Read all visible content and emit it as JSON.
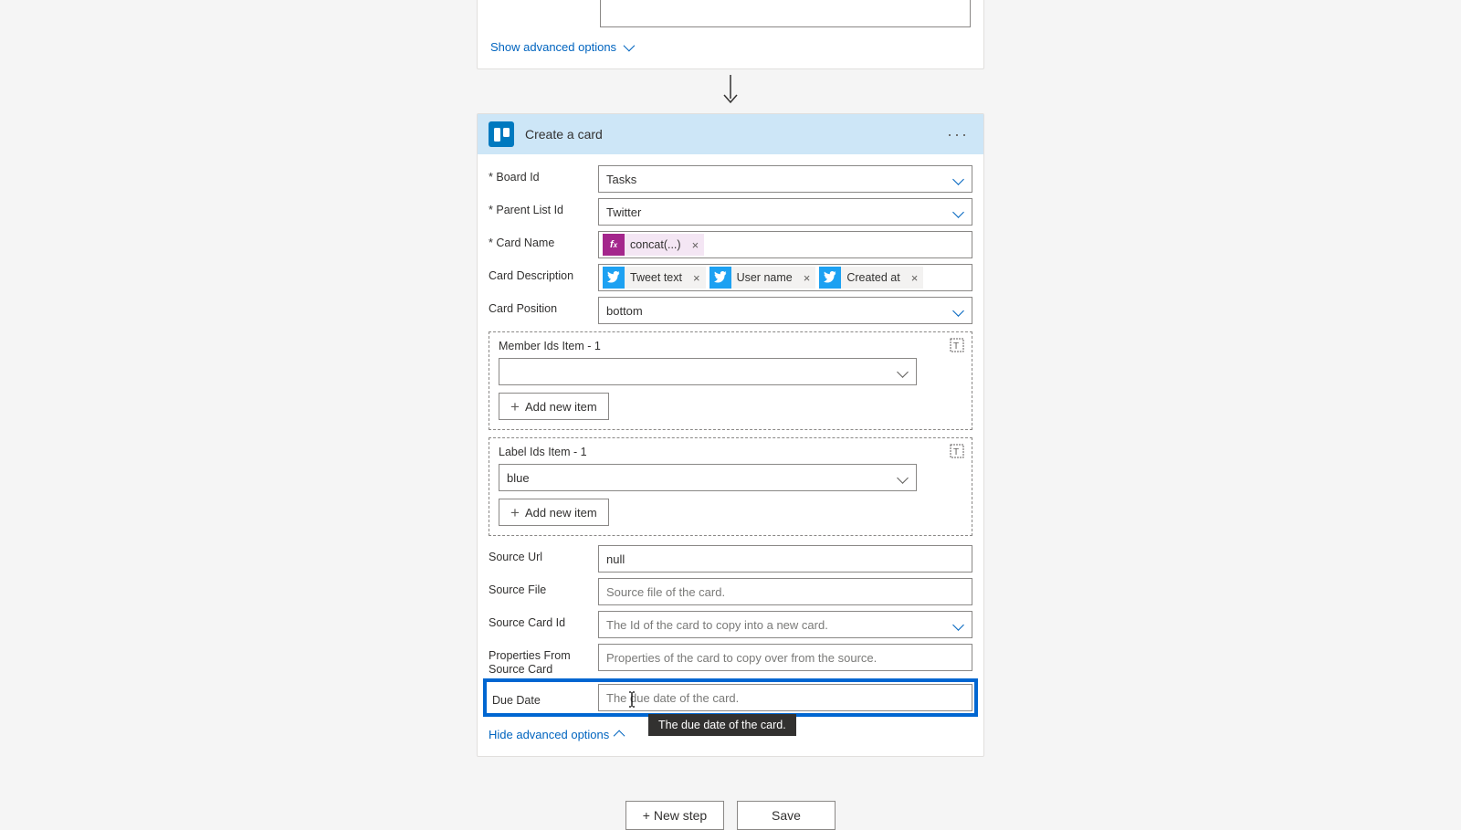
{
  "prev": {
    "show_advanced": "Show advanced options"
  },
  "header": {
    "title": "Create a card"
  },
  "fields": {
    "board": {
      "label": "Board Id",
      "value": "Tasks"
    },
    "parentList": {
      "label": "Parent List Id",
      "value": "Twitter"
    },
    "cardName": {
      "label": "Card Name",
      "token_fx": "concat(...)"
    },
    "cardDesc": {
      "label": "Card Description",
      "tokens": [
        "Tweet text",
        "User name",
        "Created at"
      ]
    },
    "cardPos": {
      "label": "Card Position",
      "value": "bottom"
    },
    "memberIds": {
      "label": "Member Ids Item - 1",
      "add": "Add new item"
    },
    "labelIds": {
      "label": "Label Ids Item - 1",
      "value": "blue",
      "add": "Add new item"
    },
    "sourceUrl": {
      "label": "Source Url",
      "value": "null"
    },
    "sourceFile": {
      "label": "Source File",
      "placeholder": "Source file of the card."
    },
    "sourceCardId": {
      "label": "Source Card Id",
      "placeholder": "The Id of the card to copy into a new card."
    },
    "propsFromSource": {
      "label": "Properties From Source Card",
      "placeholder": "Properties of the card to copy over from the source."
    },
    "dueDate": {
      "label": "Due Date",
      "placeholder": "The due date of the card."
    }
  },
  "tooltip": "The due date of the card.",
  "hide_advanced": "Hide advanced options",
  "buttons": {
    "new_step": "+ New step",
    "save": "Save"
  }
}
